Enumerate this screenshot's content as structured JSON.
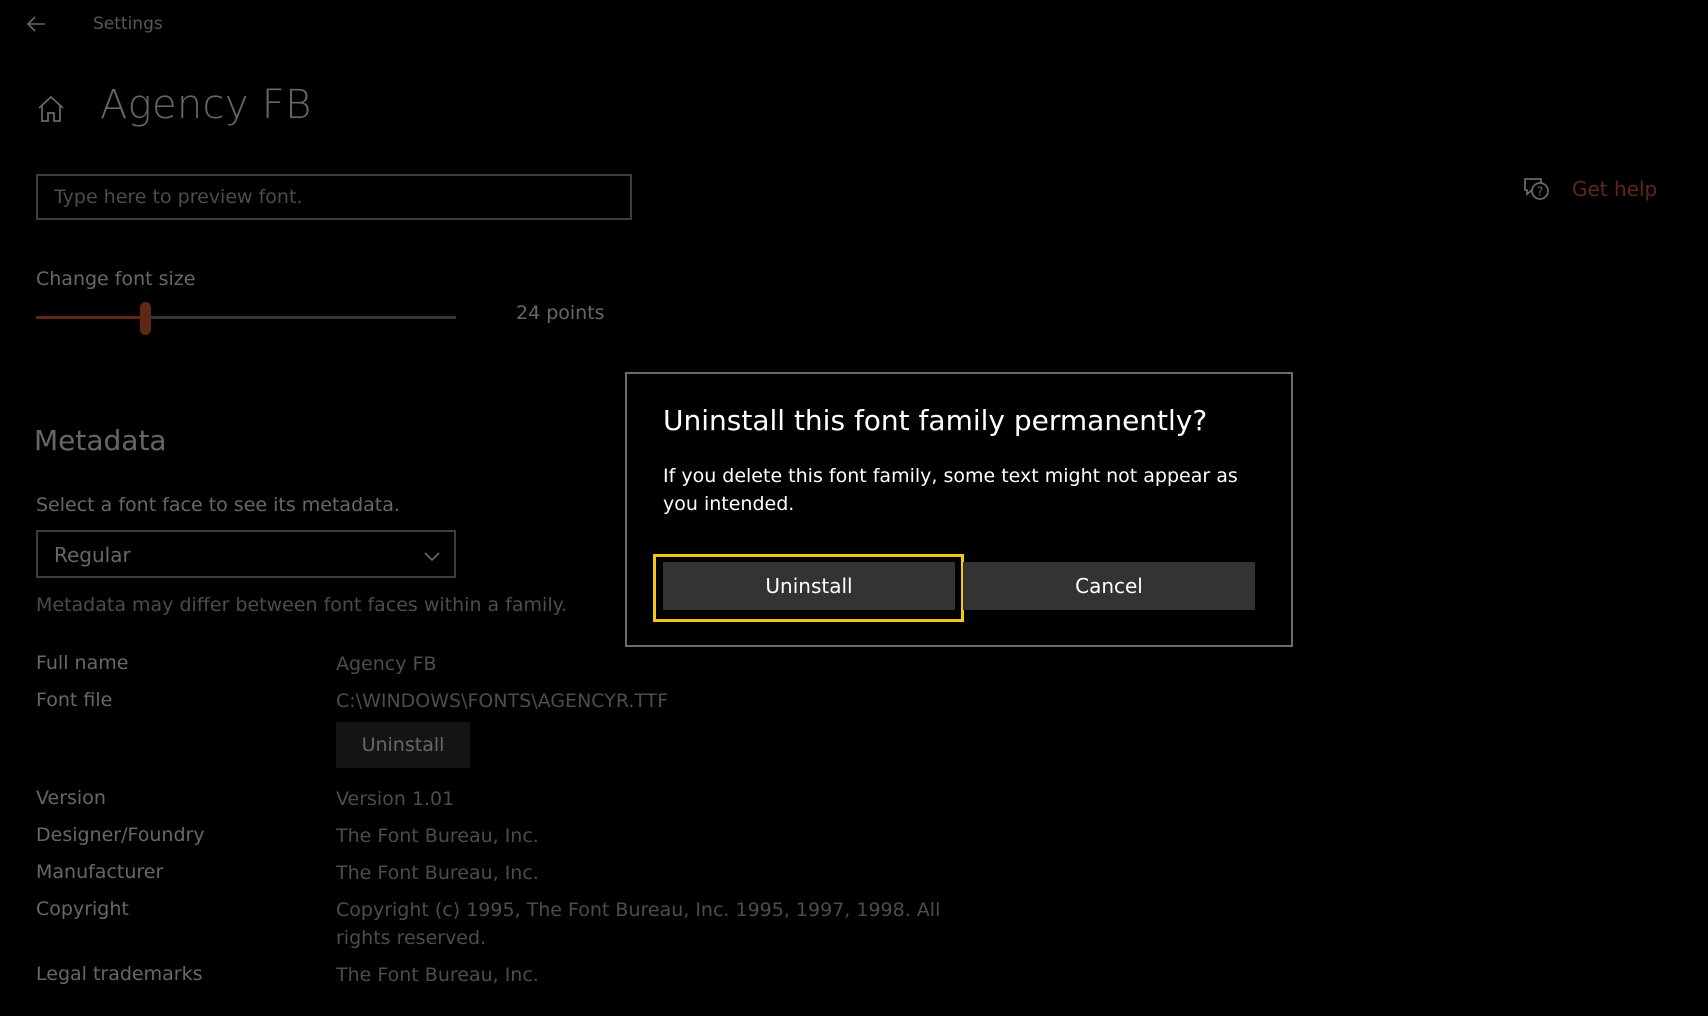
{
  "titlebar": {
    "title": "Settings"
  },
  "header": {
    "title": "Agency FB"
  },
  "preview": {
    "placeholder": "Type here to preview font."
  },
  "help": {
    "label": "Get help"
  },
  "font_size": {
    "label": "Change font size",
    "value_text": "24 points",
    "slider_fraction": 0.26
  },
  "metadata": {
    "heading": "Metadata",
    "hint": "Select a font face to see its metadata.",
    "selected_face": "Regular",
    "note": "Metadata may differ between font faces within a family.",
    "rows": [
      {
        "label": "Full name",
        "value": "Agency FB"
      },
      {
        "label": "Font file",
        "value": "C:\\WINDOWS\\FONTS\\AGENCYR.TTF"
      },
      {
        "label": "Version",
        "value": "Version 1.01"
      },
      {
        "label": "Designer/Foundry",
        "value": "The Font Bureau, Inc."
      },
      {
        "label": "Manufacturer",
        "value": "The Font Bureau, Inc."
      },
      {
        "label": "Copyright",
        "value": "Copyright (c) 1995, The Font Bureau, Inc. 1995, 1997, 1998.  All rights reserved."
      },
      {
        "label": "Legal trademarks",
        "value": "The Font Bureau, Inc."
      }
    ],
    "uninstall_label": "Uninstall"
  },
  "dialog": {
    "title": "Uninstall this font family permanently?",
    "body": "If you delete this font family, some text might not appear as you intended.",
    "uninstall_label": "Uninstall",
    "cancel_label": "Cancel"
  },
  "colors": {
    "accent": "#e8643a",
    "focus": "#f5c518",
    "button": "#333333"
  }
}
